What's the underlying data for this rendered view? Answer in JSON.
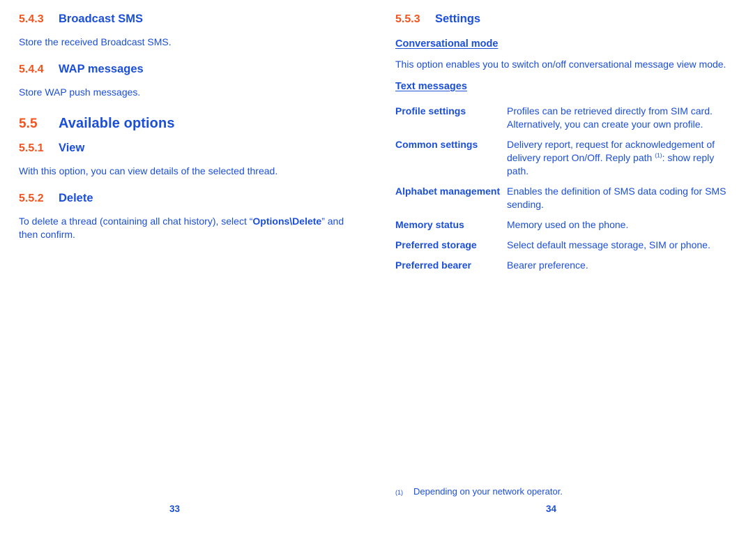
{
  "document": {
    "colors": {
      "heading_number": "#f1541f",
      "heading_text": "#1b4fd8",
      "body_text": "#1b4fd8",
      "page_background": "#ffffff"
    }
  },
  "left_page": {
    "folio": "33",
    "sections": [
      {
        "level": "minor",
        "number": "5.4.3",
        "title": "Broadcast SMS",
        "paragraph": "Store the received Broadcast SMS."
      },
      {
        "level": "minor",
        "number": "5.4.4",
        "title": "WAP messages",
        "paragraph": "Store WAP push messages."
      },
      {
        "level": "major",
        "number": "5.5",
        "title": "Available options"
      },
      {
        "level": "minor",
        "number": "5.5.1",
        "title": "View",
        "paragraph": "With this option, you can view details of the selected thread."
      },
      {
        "level": "minor",
        "number": "5.5.2",
        "title": "Delete",
        "paragraph_parts": {
          "before": "To delete a thread (containing all chat history), select “",
          "bold": "Options\\Delete",
          "after": "” and then confirm."
        }
      }
    ]
  },
  "right_page": {
    "folio": "34",
    "heading": {
      "level": "minor",
      "number": "5.5.3",
      "title": "Settings"
    },
    "subsections": [
      {
        "subhead": "Conversational mode",
        "paragraph": "This option enables you to switch on/off conversational message view mode."
      },
      {
        "subhead": "Text messages"
      }
    ],
    "settings_table": {
      "rows": [
        {
          "term": "Profile settings",
          "description": "Profiles can be retrieved directly from SIM card. Alternatively, you can create your own profile.",
          "footnote_ref": ""
        },
        {
          "term": "Common settings",
          "description_before": "Delivery report, request for acknowledgement of delivery report On/Off. Reply path ",
          "footnote_ref": "(1)",
          "description_after": ": show reply path."
        },
        {
          "term": "Alphabet management",
          "description": "Enables the definition of SMS data coding for SMS sending.",
          "footnote_ref": ""
        },
        {
          "term": "Memory status",
          "description": "Memory used on the phone.",
          "footnote_ref": ""
        },
        {
          "term": "Preferred storage",
          "description": "Select default message storage, SIM or phone.",
          "footnote_ref": ""
        },
        {
          "term": "Preferred bearer",
          "description": "Bearer preference.",
          "footnote_ref": ""
        }
      ]
    },
    "footnote": {
      "marker": "(1)",
      "text": "Depending on your network operator."
    }
  }
}
